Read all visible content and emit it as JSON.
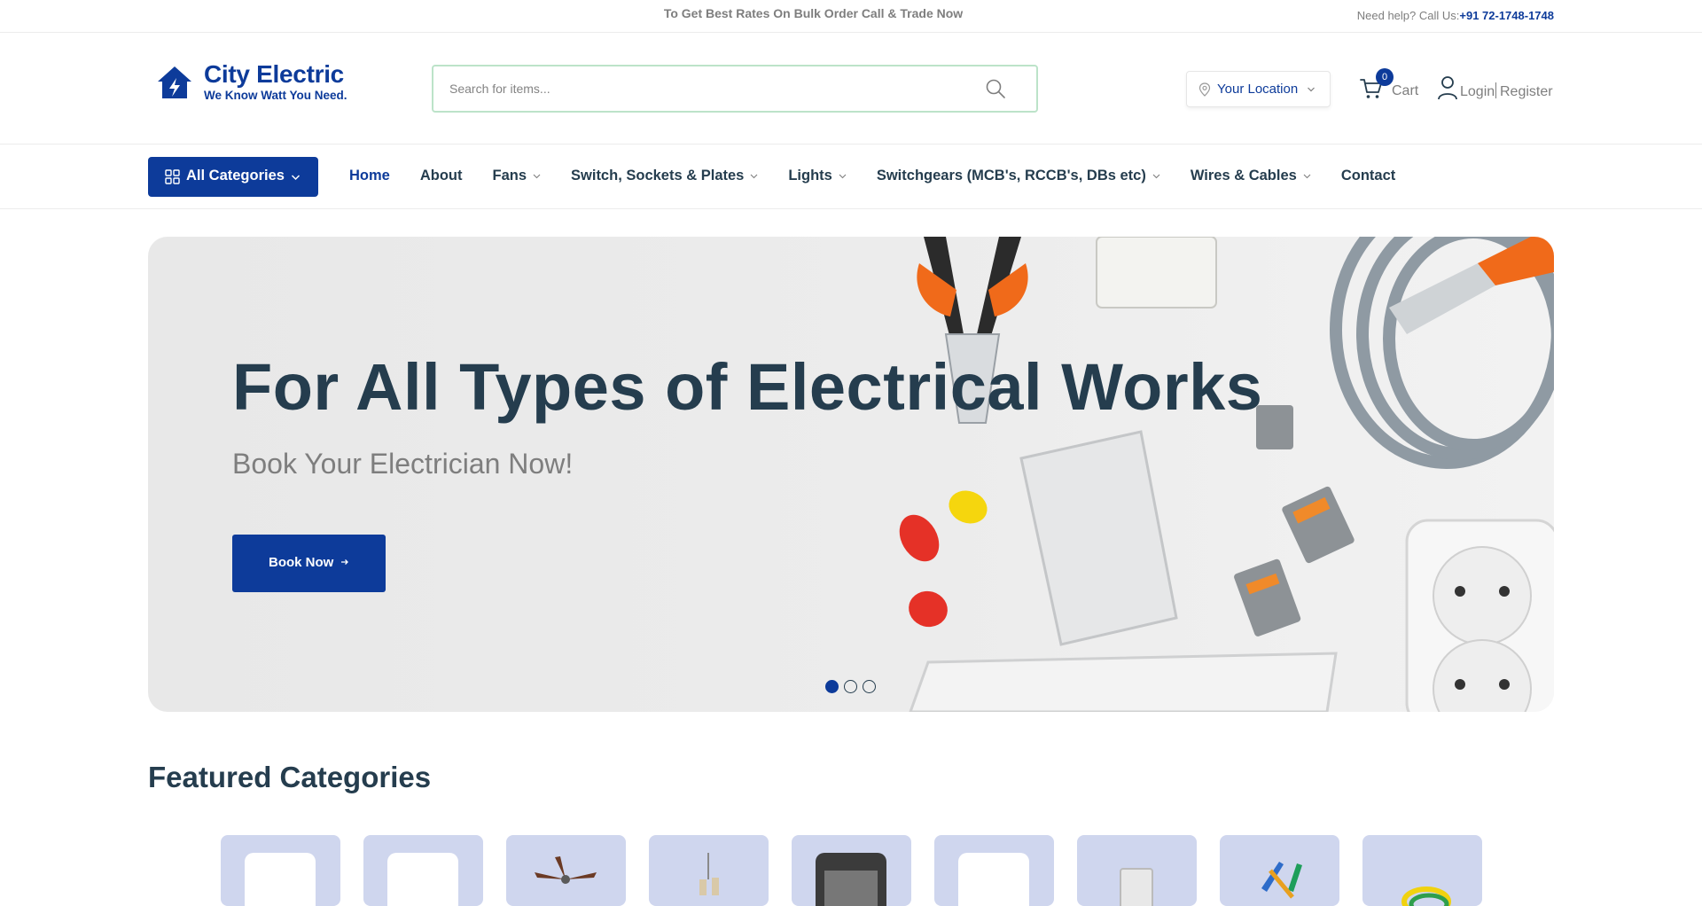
{
  "topbar": {
    "promo": "To Get Best Rates On Bulk Order Call & Trade Now",
    "help_label": "Need help? Call Us:",
    "phone": "+91 72-1748-1748"
  },
  "brand": {
    "name": "City Electric",
    "tagline": "We Know Watt You Need.",
    "color": "#0d3b9a"
  },
  "search": {
    "placeholder": "Search for items...",
    "value": ""
  },
  "location": {
    "label": "Your Location"
  },
  "cart": {
    "label": "Cart",
    "count": "0"
  },
  "account": {
    "login": "Login",
    "register": "Register"
  },
  "nav": {
    "all_categories": "All Categories",
    "items": [
      {
        "label": "Home",
        "dropdown": false,
        "active": true
      },
      {
        "label": "About",
        "dropdown": false
      },
      {
        "label": "Fans",
        "dropdown": true
      },
      {
        "label": "Switch, Sockets & Plates",
        "dropdown": true
      },
      {
        "label": "Lights",
        "dropdown": true
      },
      {
        "label": "Switchgears (MCB's, RCCB's, DBs etc)",
        "dropdown": true
      },
      {
        "label": "Wires & Cables",
        "dropdown": true
      },
      {
        "label": "Contact",
        "dropdown": false
      }
    ]
  },
  "hero": {
    "title": "For All Types of Electrical Works",
    "subtitle": "Book Your Electrician Now!",
    "button": "Book Now",
    "slides": 3,
    "active_slide": 1
  },
  "featured": {
    "title": "Featured Categories",
    "cards": 9
  }
}
